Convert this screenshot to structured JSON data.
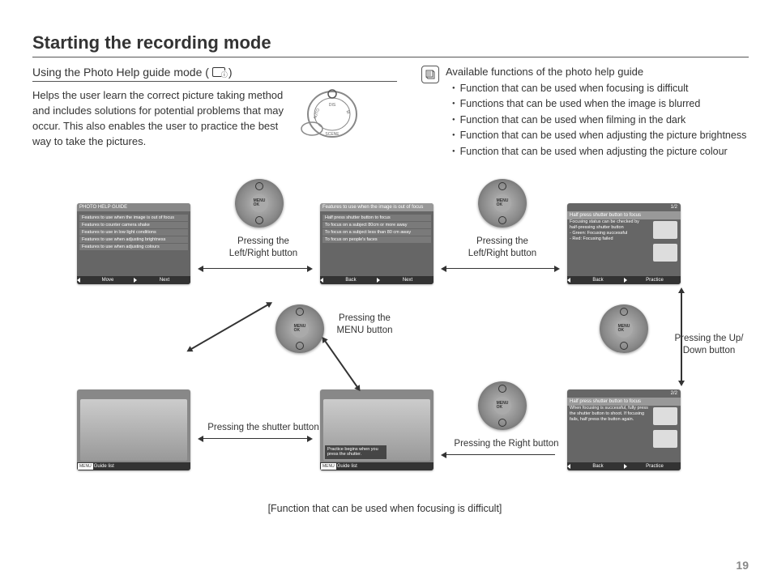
{
  "page_number": "19",
  "title": "Starting the recording mode",
  "subtitle_prefix": "Using the Photo Help guide mode (",
  "subtitle_suffix": ")",
  "intro": "Helps the user learn the correct picture taking method and includes solutions for potential problems that may occur. This also enables the user to practice the best way to take the pictures.",
  "note_title": "Available functions of the photo help guide",
  "bullets": [
    "Function that can be used when focusing is difficult",
    "Functions that can be used when the image is blurred",
    "Function that can be used when filming in the dark",
    "Function that can be used when adjusting the picture brightness",
    "Function that can be used when adjusting the picture colour"
  ],
  "screens": {
    "s1": {
      "header": "PHOTO HELP GUIDE",
      "rows": [
        "Features to use when the image is out of focus",
        "Features to counter camera shake",
        "Features to use in low light conditions",
        "Features to use when adjusting brightness",
        "Features to use when adjusting colours"
      ],
      "footer_left": "Move",
      "footer_right": "Next"
    },
    "s2": {
      "header": "Features to use when the image is out of focus",
      "rows": [
        "Half press shutter button to focus",
        "To focus on a subject 80cm or more away",
        "To focus on a subject less than 80 cm away",
        "To focus on people's faces"
      ],
      "footer_left": "Back",
      "footer_right": "Next"
    },
    "s3": {
      "page": "1/2",
      "title": "Half press shutter button to focus",
      "body": "Focusing status can be checked by half-pressing shutter button\n- Green: Focusing successful\n- Red: Focusing failed",
      "footer_left": "Back",
      "footer_right": "Practice"
    },
    "s4": {
      "page": "2/2",
      "title": "Half press shutter button to focus",
      "body": "When focusing is successful, fully press the shutter button to shoot. If focusing fails, half press the button again.",
      "footer_left": "Back",
      "footer_right": "Practice"
    },
    "s5": {
      "overlay": "Practice begins when you press the shutter.",
      "footer_left": "Guide list"
    },
    "s6": {
      "footer_left": "Guide list"
    }
  },
  "labels": {
    "lr": "Pressing the\nLeft/Right  button",
    "menu": "Pressing the\nMENU button",
    "updown": "Pressing the Up/\nDown  button",
    "right": "Pressing the Right button",
    "shutter": "Pressing the shutter button"
  },
  "menu_ok": "MENU\nOK",
  "menu_badge": "MENU",
  "bottom_caption": "[Function that can be used when focusing is difficult]"
}
